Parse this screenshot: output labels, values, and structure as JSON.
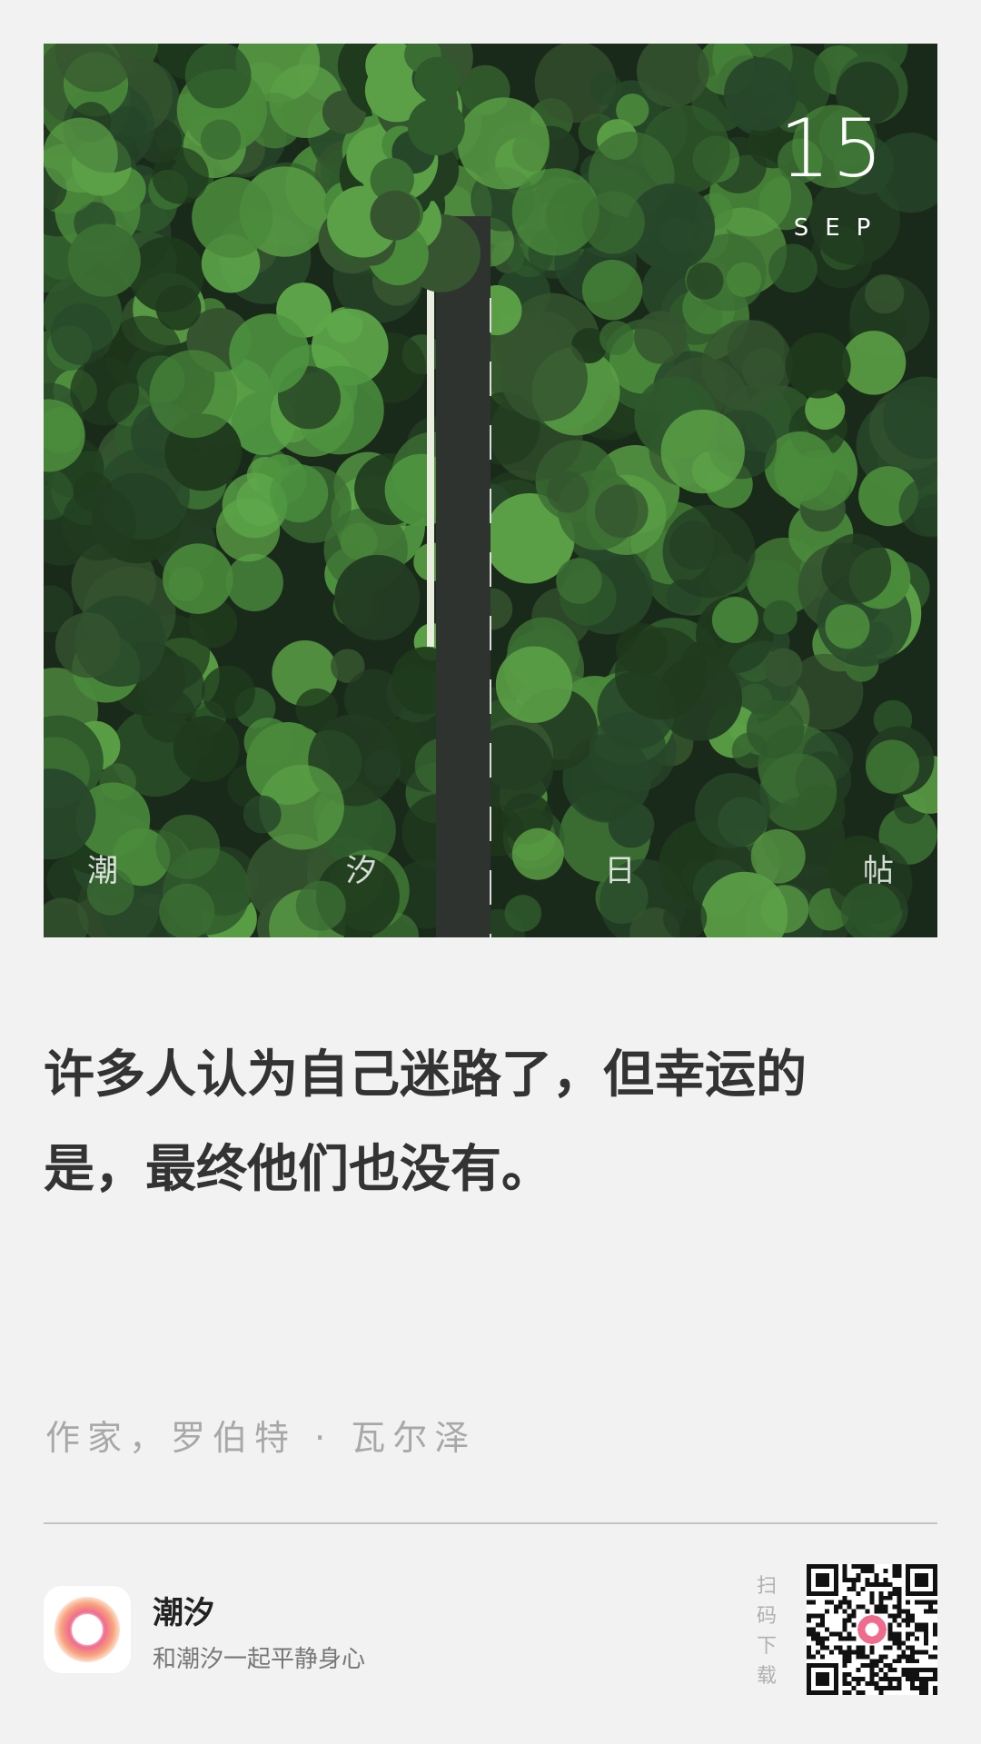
{
  "hero": {
    "date_day": "15",
    "date_month": "SEP",
    "chars": [
      "潮",
      "汐",
      "日",
      "帖"
    ]
  },
  "quote": {
    "line1": "许多人认为自己迷路了，但幸运的",
    "line2": "是，最终他们也没有。"
  },
  "author": "作家，罗伯特 · 瓦尔泽",
  "footer": {
    "app_name": "潮汐",
    "slogan": "和潮汐一起平静身心",
    "scan_chars": [
      "扫",
      "码",
      "下",
      "载"
    ]
  },
  "colors": {
    "background": "#f2f2f2",
    "quote_text": "#333333",
    "author_text": "#a8a8a8",
    "logo_pink": "#f06c8e"
  }
}
